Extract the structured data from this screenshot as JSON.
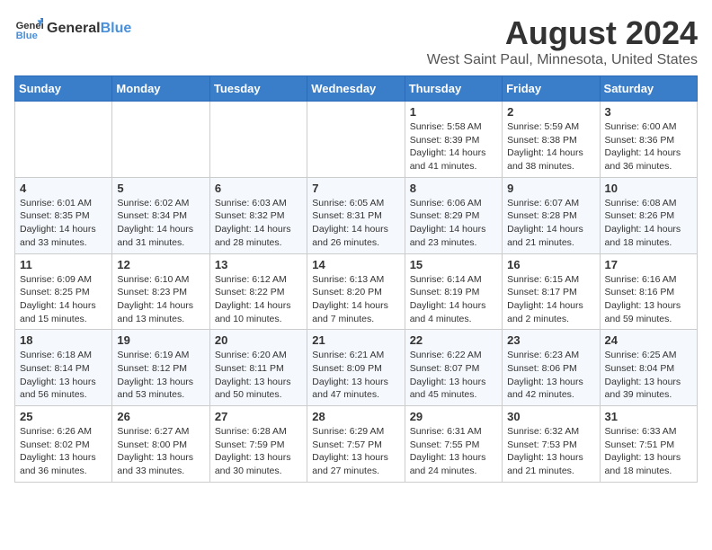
{
  "header": {
    "logo_general": "General",
    "logo_blue": "Blue",
    "main_title": "August 2024",
    "subtitle": "West Saint Paul, Minnesota, United States"
  },
  "calendar": {
    "days_of_week": [
      "Sunday",
      "Monday",
      "Tuesday",
      "Wednesday",
      "Thursday",
      "Friday",
      "Saturday"
    ],
    "weeks": [
      [
        {
          "day": "",
          "info": ""
        },
        {
          "day": "",
          "info": ""
        },
        {
          "day": "",
          "info": ""
        },
        {
          "day": "",
          "info": ""
        },
        {
          "day": "1",
          "info": "Sunrise: 5:58 AM\nSunset: 8:39 PM\nDaylight: 14 hours and 41 minutes."
        },
        {
          "day": "2",
          "info": "Sunrise: 5:59 AM\nSunset: 8:38 PM\nDaylight: 14 hours and 38 minutes."
        },
        {
          "day": "3",
          "info": "Sunrise: 6:00 AM\nSunset: 8:36 PM\nDaylight: 14 hours and 36 minutes."
        }
      ],
      [
        {
          "day": "4",
          "info": "Sunrise: 6:01 AM\nSunset: 8:35 PM\nDaylight: 14 hours and 33 minutes."
        },
        {
          "day": "5",
          "info": "Sunrise: 6:02 AM\nSunset: 8:34 PM\nDaylight: 14 hours and 31 minutes."
        },
        {
          "day": "6",
          "info": "Sunrise: 6:03 AM\nSunset: 8:32 PM\nDaylight: 14 hours and 28 minutes."
        },
        {
          "day": "7",
          "info": "Sunrise: 6:05 AM\nSunset: 8:31 PM\nDaylight: 14 hours and 26 minutes."
        },
        {
          "day": "8",
          "info": "Sunrise: 6:06 AM\nSunset: 8:29 PM\nDaylight: 14 hours and 23 minutes."
        },
        {
          "day": "9",
          "info": "Sunrise: 6:07 AM\nSunset: 8:28 PM\nDaylight: 14 hours and 21 minutes."
        },
        {
          "day": "10",
          "info": "Sunrise: 6:08 AM\nSunset: 8:26 PM\nDaylight: 14 hours and 18 minutes."
        }
      ],
      [
        {
          "day": "11",
          "info": "Sunrise: 6:09 AM\nSunset: 8:25 PM\nDaylight: 14 hours and 15 minutes."
        },
        {
          "day": "12",
          "info": "Sunrise: 6:10 AM\nSunset: 8:23 PM\nDaylight: 14 hours and 13 minutes."
        },
        {
          "day": "13",
          "info": "Sunrise: 6:12 AM\nSunset: 8:22 PM\nDaylight: 14 hours and 10 minutes."
        },
        {
          "day": "14",
          "info": "Sunrise: 6:13 AM\nSunset: 8:20 PM\nDaylight: 14 hours and 7 minutes."
        },
        {
          "day": "15",
          "info": "Sunrise: 6:14 AM\nSunset: 8:19 PM\nDaylight: 14 hours and 4 minutes."
        },
        {
          "day": "16",
          "info": "Sunrise: 6:15 AM\nSunset: 8:17 PM\nDaylight: 14 hours and 2 minutes."
        },
        {
          "day": "17",
          "info": "Sunrise: 6:16 AM\nSunset: 8:16 PM\nDaylight: 13 hours and 59 minutes."
        }
      ],
      [
        {
          "day": "18",
          "info": "Sunrise: 6:18 AM\nSunset: 8:14 PM\nDaylight: 13 hours and 56 minutes."
        },
        {
          "day": "19",
          "info": "Sunrise: 6:19 AM\nSunset: 8:12 PM\nDaylight: 13 hours and 53 minutes."
        },
        {
          "day": "20",
          "info": "Sunrise: 6:20 AM\nSunset: 8:11 PM\nDaylight: 13 hours and 50 minutes."
        },
        {
          "day": "21",
          "info": "Sunrise: 6:21 AM\nSunset: 8:09 PM\nDaylight: 13 hours and 47 minutes."
        },
        {
          "day": "22",
          "info": "Sunrise: 6:22 AM\nSunset: 8:07 PM\nDaylight: 13 hours and 45 minutes."
        },
        {
          "day": "23",
          "info": "Sunrise: 6:23 AM\nSunset: 8:06 PM\nDaylight: 13 hours and 42 minutes."
        },
        {
          "day": "24",
          "info": "Sunrise: 6:25 AM\nSunset: 8:04 PM\nDaylight: 13 hours and 39 minutes."
        }
      ],
      [
        {
          "day": "25",
          "info": "Sunrise: 6:26 AM\nSunset: 8:02 PM\nDaylight: 13 hours and 36 minutes."
        },
        {
          "day": "26",
          "info": "Sunrise: 6:27 AM\nSunset: 8:00 PM\nDaylight: 13 hours and 33 minutes."
        },
        {
          "day": "27",
          "info": "Sunrise: 6:28 AM\nSunset: 7:59 PM\nDaylight: 13 hours and 30 minutes."
        },
        {
          "day": "28",
          "info": "Sunrise: 6:29 AM\nSunset: 7:57 PM\nDaylight: 13 hours and 27 minutes."
        },
        {
          "day": "29",
          "info": "Sunrise: 6:31 AM\nSunset: 7:55 PM\nDaylight: 13 hours and 24 minutes."
        },
        {
          "day": "30",
          "info": "Sunrise: 6:32 AM\nSunset: 7:53 PM\nDaylight: 13 hours and 21 minutes."
        },
        {
          "day": "31",
          "info": "Sunrise: 6:33 AM\nSunset: 7:51 PM\nDaylight: 13 hours and 18 minutes."
        }
      ]
    ]
  }
}
